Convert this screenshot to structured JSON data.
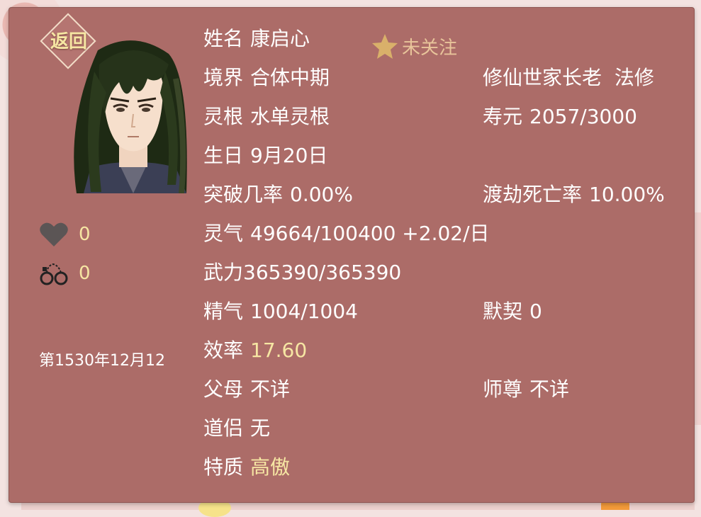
{
  "back_label": "返回",
  "follow_label": "未关注",
  "favor": "0",
  "shackle": "0",
  "date": "第1530年12月12",
  "fields": {
    "name_key": "姓名",
    "name_val": "康启心",
    "realm_key": "境界",
    "realm_val": "合体中期",
    "identity": "修仙世家长老",
    "school": "法修",
    "root_key": "灵根",
    "root_val": "水单灵根",
    "life_key": "寿元",
    "life_val": "2057/3000",
    "birth_key": "生日",
    "birth_val": "9月20日",
    "break_key": "突破几率",
    "break_val": "0.00%",
    "death_key": "渡劫死亡率",
    "death_val": "10.00%",
    "qi_key": "灵气",
    "qi_val": "49664/100400 +2.02/日",
    "power_label": "武力365390/365390",
    "essence_key": "精气",
    "essence_val": "1004/1004",
    "tacit_key": "默契",
    "tacit_val": "0",
    "eff_key": "效率",
    "eff_val": "17.60",
    "parents_key": "父母",
    "parents_val": "不详",
    "master_key": "师尊",
    "master_val": "不详",
    "partner_key": "道侣",
    "partner_val": "无",
    "trait_key": "特质",
    "trait_val": "高傲"
  },
  "colors": {
    "panel": "#ac6c68",
    "highlight": "#f6e6a3",
    "star": "#d9b06a"
  },
  "icons": {
    "favor": "heart-icon",
    "shackle": "handcuffs-icon",
    "follow": "star-icon"
  }
}
